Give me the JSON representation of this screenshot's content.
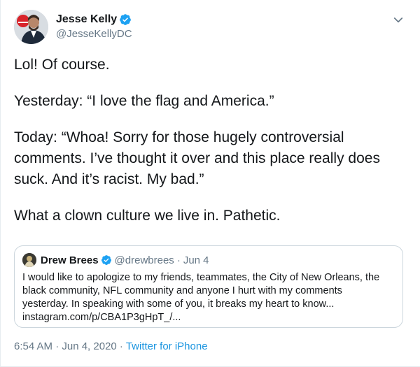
{
  "tweet": {
    "display_name": "Jesse Kelly",
    "handle": "@JesseKellyDC",
    "paragraphs": [
      "Lol! Of course.",
      "Yesterday: “I love the flag and America.”",
      "Today: “Whoa! Sorry for those hugely controversial comments. I’ve thought it over and this place really does suck. And it’s racist. My bad.”",
      "What a clown culture we live in. Pathetic."
    ],
    "timestamp": "6:54 AM · Jun 4, 2020",
    "separator": " · ",
    "source": "Twitter for iPhone"
  },
  "quote": {
    "display_name": "Drew Brees",
    "handle": "@drewbrees",
    "separator": "·",
    "date": "Jun 4",
    "lines": [
      "I would like to apologize to my friends, teammates, the City of New Orleans, the",
      "black community, NFL community and anyone I hurt with my comments",
      "yesterday. In speaking with some of you, it breaks my heart to know...",
      "instagram.com/p/CBA1P3gHpT_/..."
    ]
  },
  "icons": {
    "verified": "verified-badge-icon",
    "more": "chevron-down-icon"
  },
  "colors": {
    "verified": "#1da1f2",
    "link": "#1b95e0",
    "secondary_text": "#657786",
    "border": "#ccd6dd"
  }
}
